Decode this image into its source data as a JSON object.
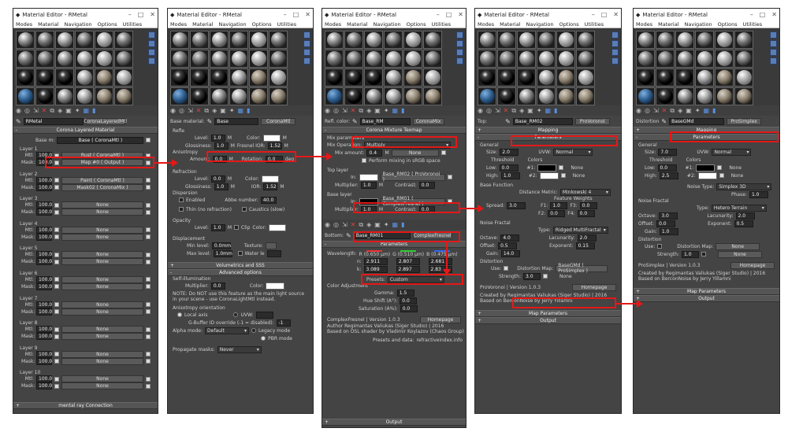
{
  "common": {
    "title": "Material Editor - RMetal",
    "menu": [
      "Modes",
      "Material",
      "Navigation",
      "Options",
      "Utilities"
    ]
  },
  "w1": {
    "name": "RMetal",
    "type": "CoronaLayeredMtl",
    "rollout_main": "Corona Layered Material",
    "base_label": "Base m:",
    "base_value": "Base  ( CoronaMtl )",
    "layers": [
      {
        "title": "Layer 1",
        "mtl_label": "Mtl:",
        "mtl_amount": "100.0",
        "mtl": "Rust  ( CoronaMtl )",
        "mask_label": "Mask:",
        "mask_amount": "100.0",
        "mask": "Map #0  ( Output )"
      },
      {
        "title": "Layer 2",
        "mtl_label": "Mtl:",
        "mtl_amount": "100.0",
        "mtl": "Paint  ( CoronaMtl )",
        "mask_label": "Mask:",
        "mask_amount": "100.0",
        "mask": "Mask02  ( CoronaMix )"
      },
      {
        "title": "Layer 3",
        "mtl_label": "Mtl:",
        "mtl_amount": "100.0",
        "mtl": "None",
        "mask_label": "Mask:",
        "mask_amount": "100.0",
        "mask": "None"
      },
      {
        "title": "Layer 4",
        "mtl_label": "Mtl:",
        "mtl_amount": "100.0",
        "mtl": "None",
        "mask_label": "Mask:",
        "mask_amount": "100.0",
        "mask": "None"
      },
      {
        "title": "Layer 5",
        "mtl_label": "Mtl:",
        "mtl_amount": "100.0",
        "mtl": "None",
        "mask_label": "Mask:",
        "mask_amount": "100.0",
        "mask": "None"
      },
      {
        "title": "Layer 6",
        "mtl_label": "Mtl:",
        "mtl_amount": "100.0",
        "mtl": "None",
        "mask_label": "Mask:",
        "mask_amount": "100.0",
        "mask": "None"
      },
      {
        "title": "Layer 7",
        "mtl_label": "Mtl:",
        "mtl_amount": "100.0",
        "mtl": "None",
        "mask_label": "Mask:",
        "mask_amount": "100.0",
        "mask": "None"
      },
      {
        "title": "Layer 8",
        "mtl_label": "Mtl:",
        "mtl_amount": "100.0",
        "mtl": "None",
        "mask_label": "Mask:",
        "mask_amount": "100.0",
        "mask": "None"
      },
      {
        "title": "Layer 9",
        "mtl_label": "Mtl:",
        "mtl_amount": "100.0",
        "mtl": "None",
        "mask_label": "Mask:",
        "mask_amount": "100.0",
        "mask": "None"
      },
      {
        "title": "Layer 10",
        "mtl_label": "Mtl:",
        "mtl_amount": "100.0",
        "mtl": "None",
        "mask_label": "Mask:",
        "mask_amount": "100.0",
        "mask": "None"
      }
    ],
    "rollout_bottom": "mental ray Connection"
  },
  "w2": {
    "label": "Base material:",
    "name": "Base",
    "type": "CoronaMtl",
    "refl": "Refle",
    "level_label": "Level:",
    "level": "1.0",
    "color_label": "Color:",
    "gloss_label": "Glossiness:",
    "gloss": "1.0",
    "ior_label": "Fresnel IOR:",
    "ior": "1.52",
    "aniso": "Anisotropy",
    "amount_label": "Amount:",
    "amount": "0.0",
    "rotation_label": "Rotation:",
    "rotation": "0.0",
    "deg": "deg",
    "refraction": "Refraction",
    "r_level": "0.0",
    "r_gloss": "1.0",
    "r_ior_label": "IOR:",
    "r_ior": "1.52",
    "dispersion": "Dispersion",
    "enabled": "Enabled",
    "abbe_label": "Abbe number:",
    "abbe": "40.0",
    "thin": "Thin (no refraction)",
    "caustics": "Caustics (slow)",
    "opacity": "Opacity",
    "o_level": "1.0",
    "clip": "Clip",
    "displacement": "Displacement",
    "min_label": "Min level:",
    "min": "0.0mm",
    "texture_label": "Texture:",
    "max_label": "Max level:",
    "max": "1.0mm",
    "water_label": "Water le",
    "roll_vol": "Volumetrics and SSS",
    "roll_adv": "Advanced options",
    "selfillum": "Self-illumination",
    "mult_label": "Multiplier:",
    "mult": "0.0",
    "note": "NOTE: Do NOT use this feature as the main light source in your scene - use CoronaLightMtl instead.",
    "aniso_orient": "Anisotropy orientation",
    "local_axis": "Local axis",
    "uvw": "UVW:",
    "gbuf": "G-Buffer ID override (-1 = disabled):",
    "gbuf_val": "-1",
    "alpha_label": "Alpha mode:",
    "alpha": "Default",
    "legacy": "Legacy mode",
    "pbr": "PBR mode",
    "prop_label": "Propagate masks:",
    "prop": "Never"
  },
  "w3": {
    "label": "Refl. color:",
    "name": "Base_RM",
    "type": "CoronaMix",
    "roll_main": "Corona Mixture Texmap",
    "mix_params": "Mix parameters",
    "mixop_label": "Mix Operation:",
    "mixop": "Multiply",
    "mixamt_label": "Mix amount:",
    "mixamt": "0.4",
    "none": "None",
    "perform": "Perform mixing in sRGB space",
    "top_layer": "Top layer",
    "top_in": "In:",
    "top_map": "Base_RM02  ( ProVoronoi )",
    "mult_label": "Multiplier:",
    "mult": "1.0",
    "contrast_label": "Contrast:",
    "contrast": "0.0",
    "base_layer": "Base layer",
    "base_map": "Base_RM01  ( ComplexFresnel )",
    "b_mult": "1.0",
    "b_contrast": "0.0",
    "bottom_label": "Bottom:",
    "bottom_name": "Base_RM01",
    "bottom_type": "ComplexFresnel",
    "params": "Parameters",
    "wl_label": "Wavelength:",
    "r_val": "R (0.650 μm)",
    "g_val": "G (0.510 μm)",
    "b_val": "B (0.475 μm)",
    "n_label": "n:",
    "n_r": "2.911",
    "n_g": "2.807",
    "n_b": "2.681",
    "k_label": "k:",
    "k_r": "3.089",
    "k_g": "2.897",
    "k_b": "2.83",
    "presets_label": "Presets:",
    "presets": "Custom",
    "color_adj": "Color Adjustment",
    "gamma_label": "Gamma:",
    "gamma": "1.5",
    "hue_label": "Hue Shift (A°):",
    "hue": "0.0",
    "sat_label": "Saturation (A%):",
    "sat": "0.0",
    "version": "ComplexFresnel  |  Version 1.0.3",
    "homepage": "Homepage",
    "author1": "Author Regimantas Valiukas (Siger Studio)  |  2016",
    "author2": "Based on OSL shader by Vladimir Koylazov (Chaos Group)",
    "presets_data": "Presets and data:",
    "refractive": "refractiveindex.info",
    "output": "Output"
  },
  "w4": {
    "label": "Top:",
    "name": "Base_RM02",
    "type": "ProVoronoi",
    "mapping": "Mapping",
    "params": "Parameters",
    "general": "General",
    "size_label": "Size:",
    "size": "2.0",
    "uvw_label": "UVW:",
    "uvw": "Normal",
    "threshold": "Threshold",
    "colors": "Colors",
    "low_label": "Low:",
    "low": "0.0",
    "c1": "#1:",
    "none1": "None",
    "high_label": "High:",
    "high": "1.0",
    "c2": "#2:",
    "none2": "None",
    "base_func": "Base Function",
    "dist_label": "Distance Metric:",
    "dist": "Minkowski 4",
    "feat": "Feature Weights",
    "spread_label": "Spread:",
    "spread": "3.0",
    "f1_label": "F1:",
    "f1": "1.0",
    "f3_label": "F3:",
    "f3": "0.0",
    "f2_label": "F2:",
    "f2": "0.0",
    "f4_label": "F4:",
    "f4": "0.0",
    "noise_fractal": "Noise Fractal",
    "type_label": "Type:",
    "type_val": "Ridged MultiFractal",
    "oct_label": "Octave:",
    "oct": "4.0",
    "lac_label": "Lacunarity:",
    "lac": "2.0",
    "off_label": "Offset:",
    "off": "0.5",
    "exp_label": "Exponent:",
    "exp": "0.15",
    "gain_label": "Gain:",
    "gain": "14.0",
    "distortion": "Distortion",
    "use_label": "Use:",
    "distmap_label": "Distortion Map:",
    "distmap": "BaseGMd  ( ProSimplex )",
    "str_label": "Strength:",
    "str": "3.0",
    "none3": "None",
    "version": "ProVoronoi  |  Version 1.0.3",
    "homepage": "Homepage",
    "author1": "Created by Regimantas Valiukas (Siger Studio)  |  2016",
    "author2": "Based on BerconNoise by Jerry Yillamni",
    "map_params": "Map Parameters",
    "output": "Output"
  },
  "w5": {
    "label": "Distortion",
    "name": "BaseGMd",
    "type": "ProSimplex",
    "mapping": "Mapping",
    "params": "Parameters",
    "general": "General",
    "size_label": "Size:",
    "size": "7.0",
    "uvw_label": "UVW:",
    "uvw": "Normal",
    "threshold": "Threshold",
    "colors": "Colors",
    "low_label": "Low:",
    "low": "0.0",
    "c1": "#1:",
    "none1": "None",
    "high_label": "High:",
    "high": "2.5",
    "c2": "#2:",
    "none2": "None",
    "noise_type_label": "Noise Type:",
    "noise_type": "Simplex 3D",
    "phase_label": "Phase:",
    "phase": "1.0",
    "noise_fractal": "Noise Fractal",
    "type_label": "Type:",
    "type_val": "Hetero Terrain",
    "oct_label": "Octave:",
    "oct": "3.0",
    "lac_label": "Lacunarity:",
    "lac": "2.0",
    "off_label": "Offset:",
    "off": "0.0",
    "exp_label": "Exponent:",
    "exp": "0.5",
    "gain_label": "Gain:",
    "gain": "1.0",
    "distortion": "Distortion",
    "use_label": "Use:",
    "distmap_label": "Distortion Map:",
    "distmap": "None",
    "str_label": "Strength:",
    "str": "1.0",
    "none3": "None",
    "version": "ProSimplex  |  Version 1.0.3",
    "homepage": "Homepage",
    "author1": "Created by Regimantas Valiukas (Siger Studio)  |  2016",
    "author2": "Based on BerconNoise by Jerry Yillamni",
    "map_params": "Map Parameters",
    "output": "Output"
  },
  "colors": {
    "annotation": "#e51818",
    "panel": "#444444",
    "accent": "#5a7db5"
  }
}
